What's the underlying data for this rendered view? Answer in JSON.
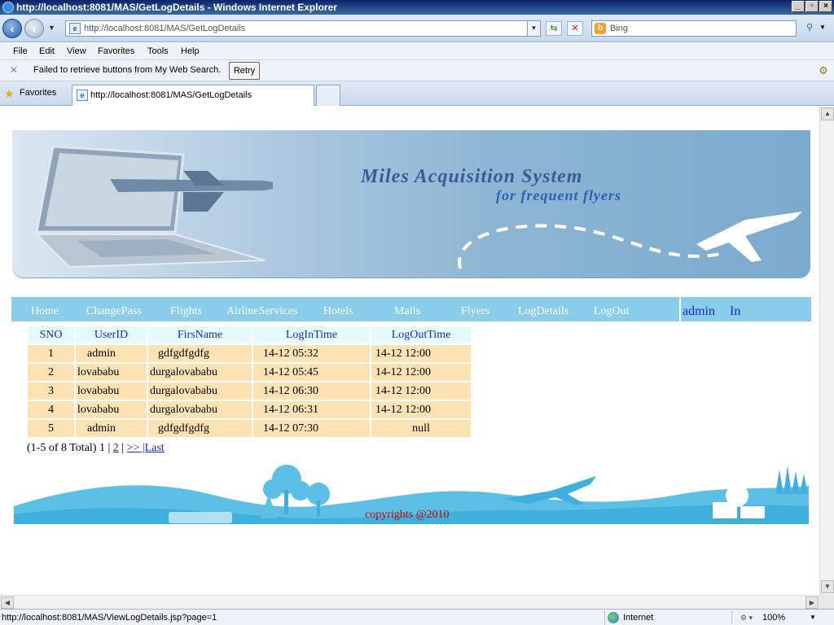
{
  "window": {
    "title": "http://localhost:8081/MAS/GetLogDetails - Windows Internet Explorer",
    "address": "http://localhost:8081/MAS/GetLogDetails",
    "search_placeholder": "Bing"
  },
  "menu": [
    "File",
    "Edit",
    "View",
    "Favorites",
    "Tools",
    "Help"
  ],
  "search_error": {
    "message": "Failed to retrieve buttons from My Web Search.",
    "retry_label": "Retry"
  },
  "favorites_label": "Favorites",
  "tab_title": "http://localhost:8081/MAS/GetLogDetails",
  "banner": {
    "title": "Miles Acquisition System",
    "subtitle": "for frequent flyers"
  },
  "nav": {
    "items": [
      "Home",
      "ChangePass",
      "Flights",
      "AirlineServices",
      "Hotels",
      "Mails",
      "Flyers",
      "LogDetails",
      "LogOut"
    ],
    "user": "admin",
    "status": "In"
  },
  "table": {
    "headers": [
      "SNO",
      "UserID",
      "FirsName",
      "LogInTime",
      "LogOutTime"
    ],
    "rows": [
      [
        "1",
        "admin",
        "gdfgdfgdfg",
        "14-12 05:32",
        "14-12 12:00"
      ],
      [
        "2",
        "lovababu",
        "durgalovababu",
        "14-12 05:45",
        "14-12 12:00"
      ],
      [
        "3",
        "lovababu",
        "durgalovababu",
        "14-12 06:30",
        "14-12 12:00"
      ],
      [
        "4",
        "lovababu",
        "durgalovababu",
        "14-12 06:31",
        "14-12 12:00"
      ],
      [
        "5",
        "admin",
        "gdfgdfgdfg",
        "14-12 07:30",
        "null"
      ]
    ]
  },
  "pager": {
    "summary": "(1-5 of 8 Total) 1 |",
    "page2": "2",
    "sep": "|",
    "next": ">> |Last"
  },
  "footer": {
    "copyright": "copyrights @2010"
  },
  "status": {
    "url": "http://localhost:8081/MAS/ViewLogDetails.jsp?page=1",
    "zone": "Internet",
    "zoom": "100%"
  }
}
